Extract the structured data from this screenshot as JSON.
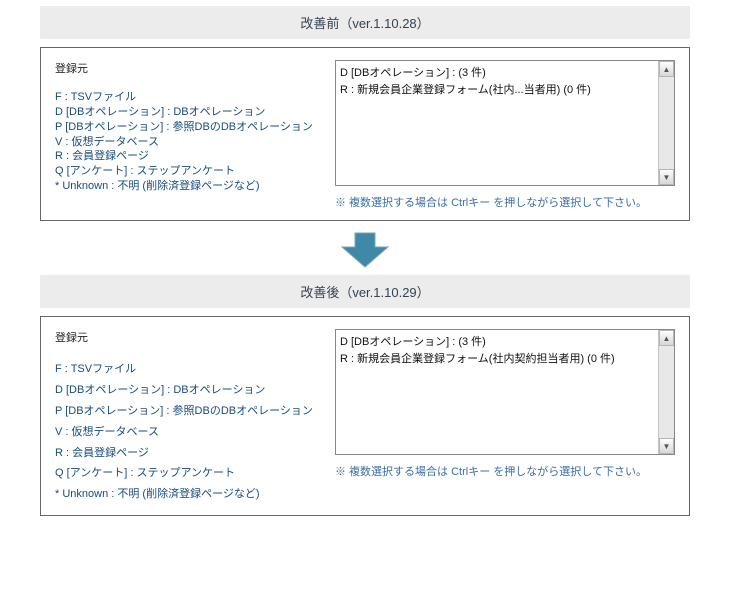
{
  "before": {
    "header": "改善前（ver.1.10.28）",
    "left_title": "登録元",
    "legend": [
      "F : TSVファイル",
      "D [DBオペレーション] : DBオペレーション",
      "P [DBオペレーション] : 参照DBのDBオペレーション",
      "V : 仮想データベース",
      "R : 会員登録ページ",
      "Q [アンケート] : ステップアンケート",
      "* Unknown : 不明 (削除済登録ページなど)"
    ],
    "list_items": [
      "D [DBオペレーション] : (3 件)",
      "R : 新規会員企業登録フォーム(社内...当者用) (0 件)"
    ],
    "note": "※ 複数選択する場合は Ctrlキー を押しながら選択して下さい。"
  },
  "after": {
    "header": "改善後（ver.1.10.29）",
    "left_title": "登録元",
    "legend": [
      "F : TSVファイル",
      "D [DBオペレーション] : DBオペレーション",
      "P [DBオペレーション] : 参照DBのDBオペレーション",
      "V : 仮想データベース",
      "R : 会員登録ページ",
      "Q [アンケート] : ステップアンケート",
      "* Unknown : 不明 (削除済登録ページなど)"
    ],
    "list_items": [
      "D [DBオペレーション] : (3 件)",
      "R : 新規会員企業登録フォーム(社内契約担当者用) (0 件)"
    ],
    "note": "※ 複数選択する場合は Ctrlキー を押しながら選択して下さい。"
  },
  "icons": {
    "down_arrow": "down-arrow-icon",
    "scroll_up": "▲",
    "scroll_down": "▼"
  },
  "colors": {
    "header_bg": "#ececec",
    "header_text": "#344252",
    "legend_text": "#184c7a",
    "note_text": "#3b6ea5",
    "arrow_fill": "#4089a6",
    "arrow_stroke": "#2a6b85"
  }
}
